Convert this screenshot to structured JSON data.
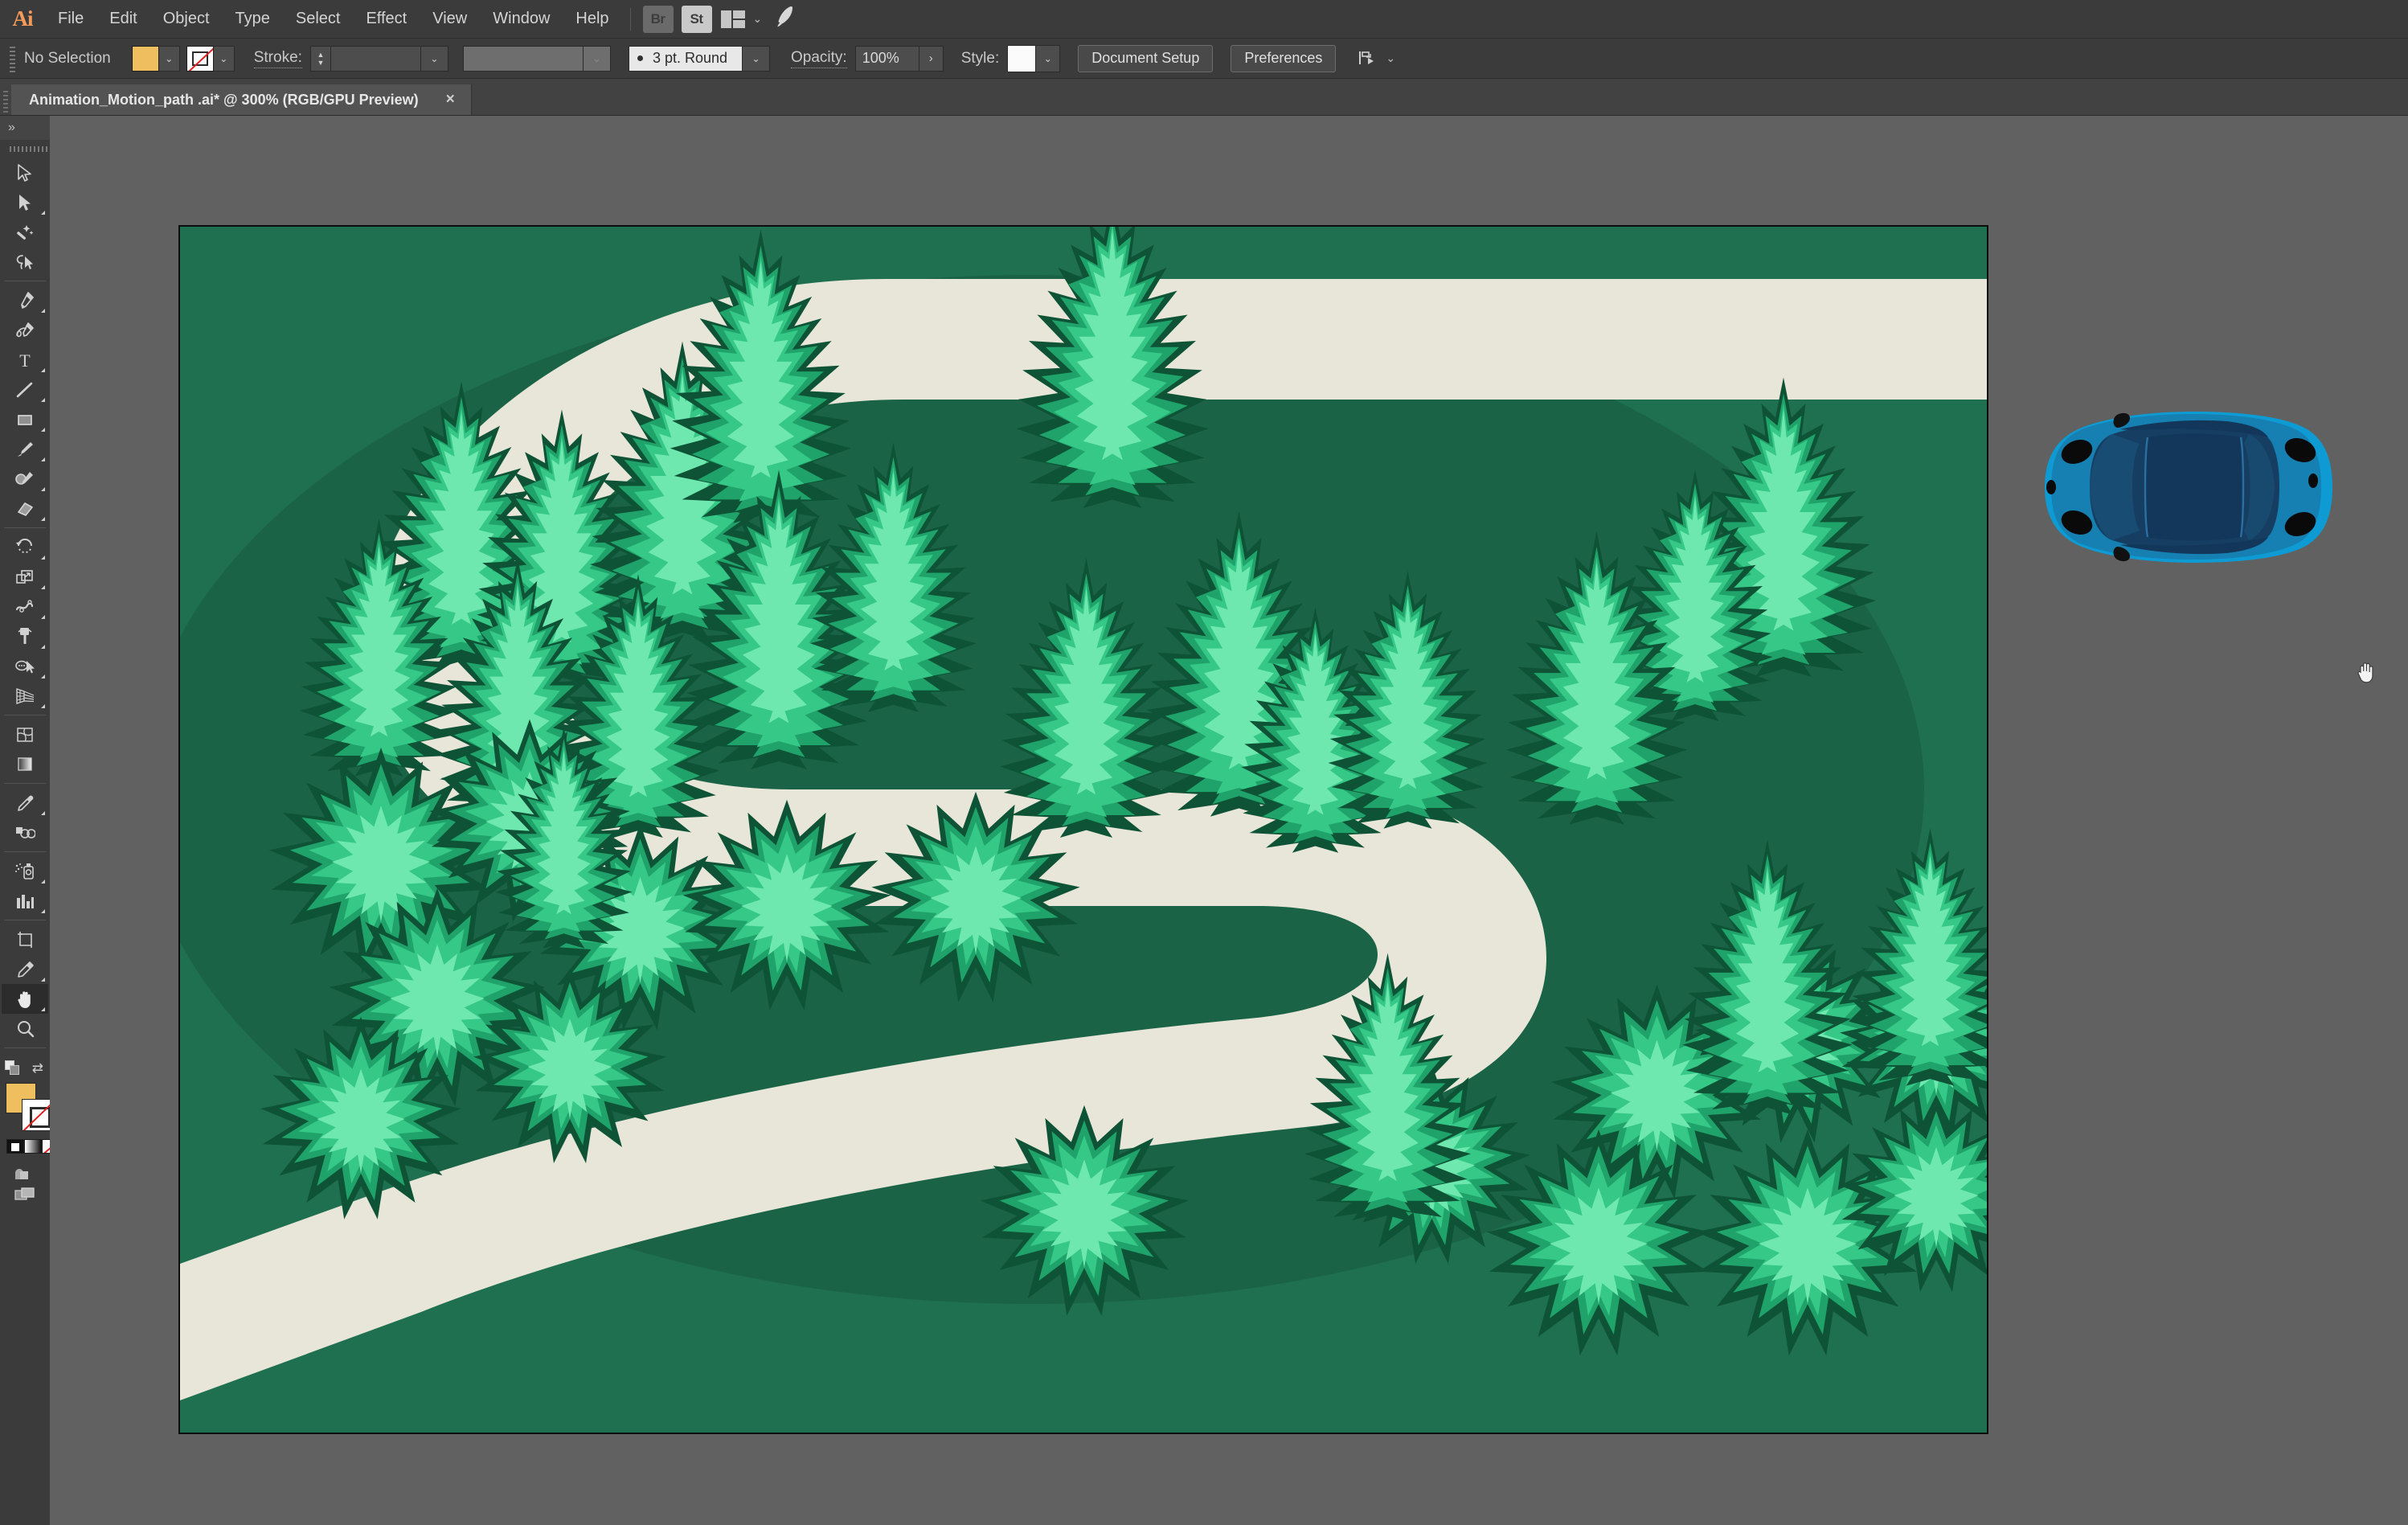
{
  "app": {
    "name": "Adobe Illustrator",
    "logo_text": "Ai"
  },
  "menubar": {
    "items": [
      {
        "label": "File"
      },
      {
        "label": "Edit"
      },
      {
        "label": "Object"
      },
      {
        "label": "Type"
      },
      {
        "label": "Select"
      },
      {
        "label": "Effect"
      },
      {
        "label": "View"
      },
      {
        "label": "Window"
      },
      {
        "label": "Help"
      }
    ],
    "bridge_label": "Br",
    "stock_label": "St",
    "layout_icon": "arrange-documents-icon",
    "layout_chevron": "⌄",
    "rocket_icon": "🚀"
  },
  "controlbar": {
    "selection_status": "No Selection",
    "fill_color": "#EFBE5E",
    "fill_dropdown_chevron": "⌄",
    "stroke_color": "None",
    "stroke_dropdown_chevron": "⌄",
    "stroke_label": "Stroke:",
    "stroke_weight_value": "",
    "stroke_weight_chevron": "⌄",
    "variable_width_value": "",
    "variable_width_chevron": "⌄",
    "brush_definition": "3 pt. Round",
    "opacity_label": "Opacity:",
    "opacity_value": "100%",
    "opacity_arrow": "›",
    "style_label": "Style:",
    "style_swatch_color": "#FBFBFB",
    "style_chevron": "⌄",
    "document_setup_button": "Document Setup",
    "preferences_button": "Preferences",
    "align_icon": "align-to-selection-icon",
    "align_chevron": "⌄"
  },
  "tabbar": {
    "tabs": [
      {
        "title": "Animation_Motion_path .ai* @ 300% (RGB/GPU Preview)",
        "close_label": "×",
        "active": true
      }
    ]
  },
  "left_panel": {
    "collapse_label": "»",
    "tools": [
      {
        "name": "selection-tool",
        "has_flyout": false
      },
      {
        "name": "direct-selection-tool",
        "has_flyout": true
      },
      {
        "name": "magic-wand-tool",
        "has_flyout": false
      },
      {
        "name": "lasso-tool",
        "has_flyout": false
      },
      {
        "name": "pen-tool",
        "has_flyout": true
      },
      {
        "name": "curvature-tool",
        "has_flyout": false
      },
      {
        "name": "type-tool",
        "has_flyout": true
      },
      {
        "name": "line-segment-tool",
        "has_flyout": true
      },
      {
        "name": "rectangle-tool",
        "has_flyout": true
      },
      {
        "name": "paintbrush-tool",
        "has_flyout": true
      },
      {
        "name": "shaper-tool",
        "has_flyout": true
      },
      {
        "name": "eraser-tool",
        "has_flyout": true
      },
      {
        "name": "rotate-tool",
        "has_flyout": true
      },
      {
        "name": "scale-tool",
        "has_flyout": true
      },
      {
        "name": "width-tool",
        "has_flyout": true
      },
      {
        "name": "free-transform-tool",
        "has_flyout": true
      },
      {
        "name": "shape-builder-tool",
        "has_flyout": true
      },
      {
        "name": "perspective-grid-tool",
        "has_flyout": true
      },
      {
        "name": "mesh-tool",
        "has_flyout": false
      },
      {
        "name": "gradient-tool",
        "has_flyout": false
      },
      {
        "name": "eyedropper-tool",
        "has_flyout": true
      },
      {
        "name": "blend-tool",
        "has_flyout": false
      },
      {
        "name": "symbol-sprayer-tool",
        "has_flyout": true
      },
      {
        "name": "column-graph-tool",
        "has_flyout": true
      },
      {
        "name": "artboard-tool",
        "has_flyout": false
      },
      {
        "name": "slice-tool",
        "has_flyout": true
      },
      {
        "name": "hand-tool",
        "has_flyout": true,
        "active": true
      },
      {
        "name": "zoom-tool",
        "has_flyout": false
      }
    ],
    "color_controls": {
      "fill_color": "#EFBE5E",
      "stroke_color": "None",
      "swap_icon": "⇄",
      "default_colors_icon": "default-fill-stroke-icon",
      "mode_color_icon": "color-mode-icon",
      "mode_gradient_icon": "gradient-mode-icon",
      "mode_none_icon": "none-mode-icon",
      "drawing_mode_icon": "draw-normal-icon",
      "screen_mode_icon": "change-screen-mode-icon"
    }
  },
  "canvas": {
    "background_color": "#616161",
    "cursor": "hand-cursor",
    "artboard": {
      "background_color": "#1F7050",
      "shadow_color": "#1A5F43",
      "road_color": "#E8E6D8",
      "tree_colors": {
        "darkest": "#0E5336",
        "dark": "#17684A",
        "mid": "#1FA36A",
        "light": "#35C886",
        "lightest": "#6FE8B0"
      },
      "zoom_percent": "300%",
      "color_mode": "RGB",
      "preview_mode": "GPU Preview"
    },
    "car_object": {
      "name": "blue-car-top-view",
      "body_color": "#0E9BD4",
      "body_shade_color": "#1B6A93",
      "window_color": "#163E63",
      "roof_color": "#12375A",
      "wheel_color": "#0A0A0A",
      "mirror_color": "#111111"
    }
  }
}
